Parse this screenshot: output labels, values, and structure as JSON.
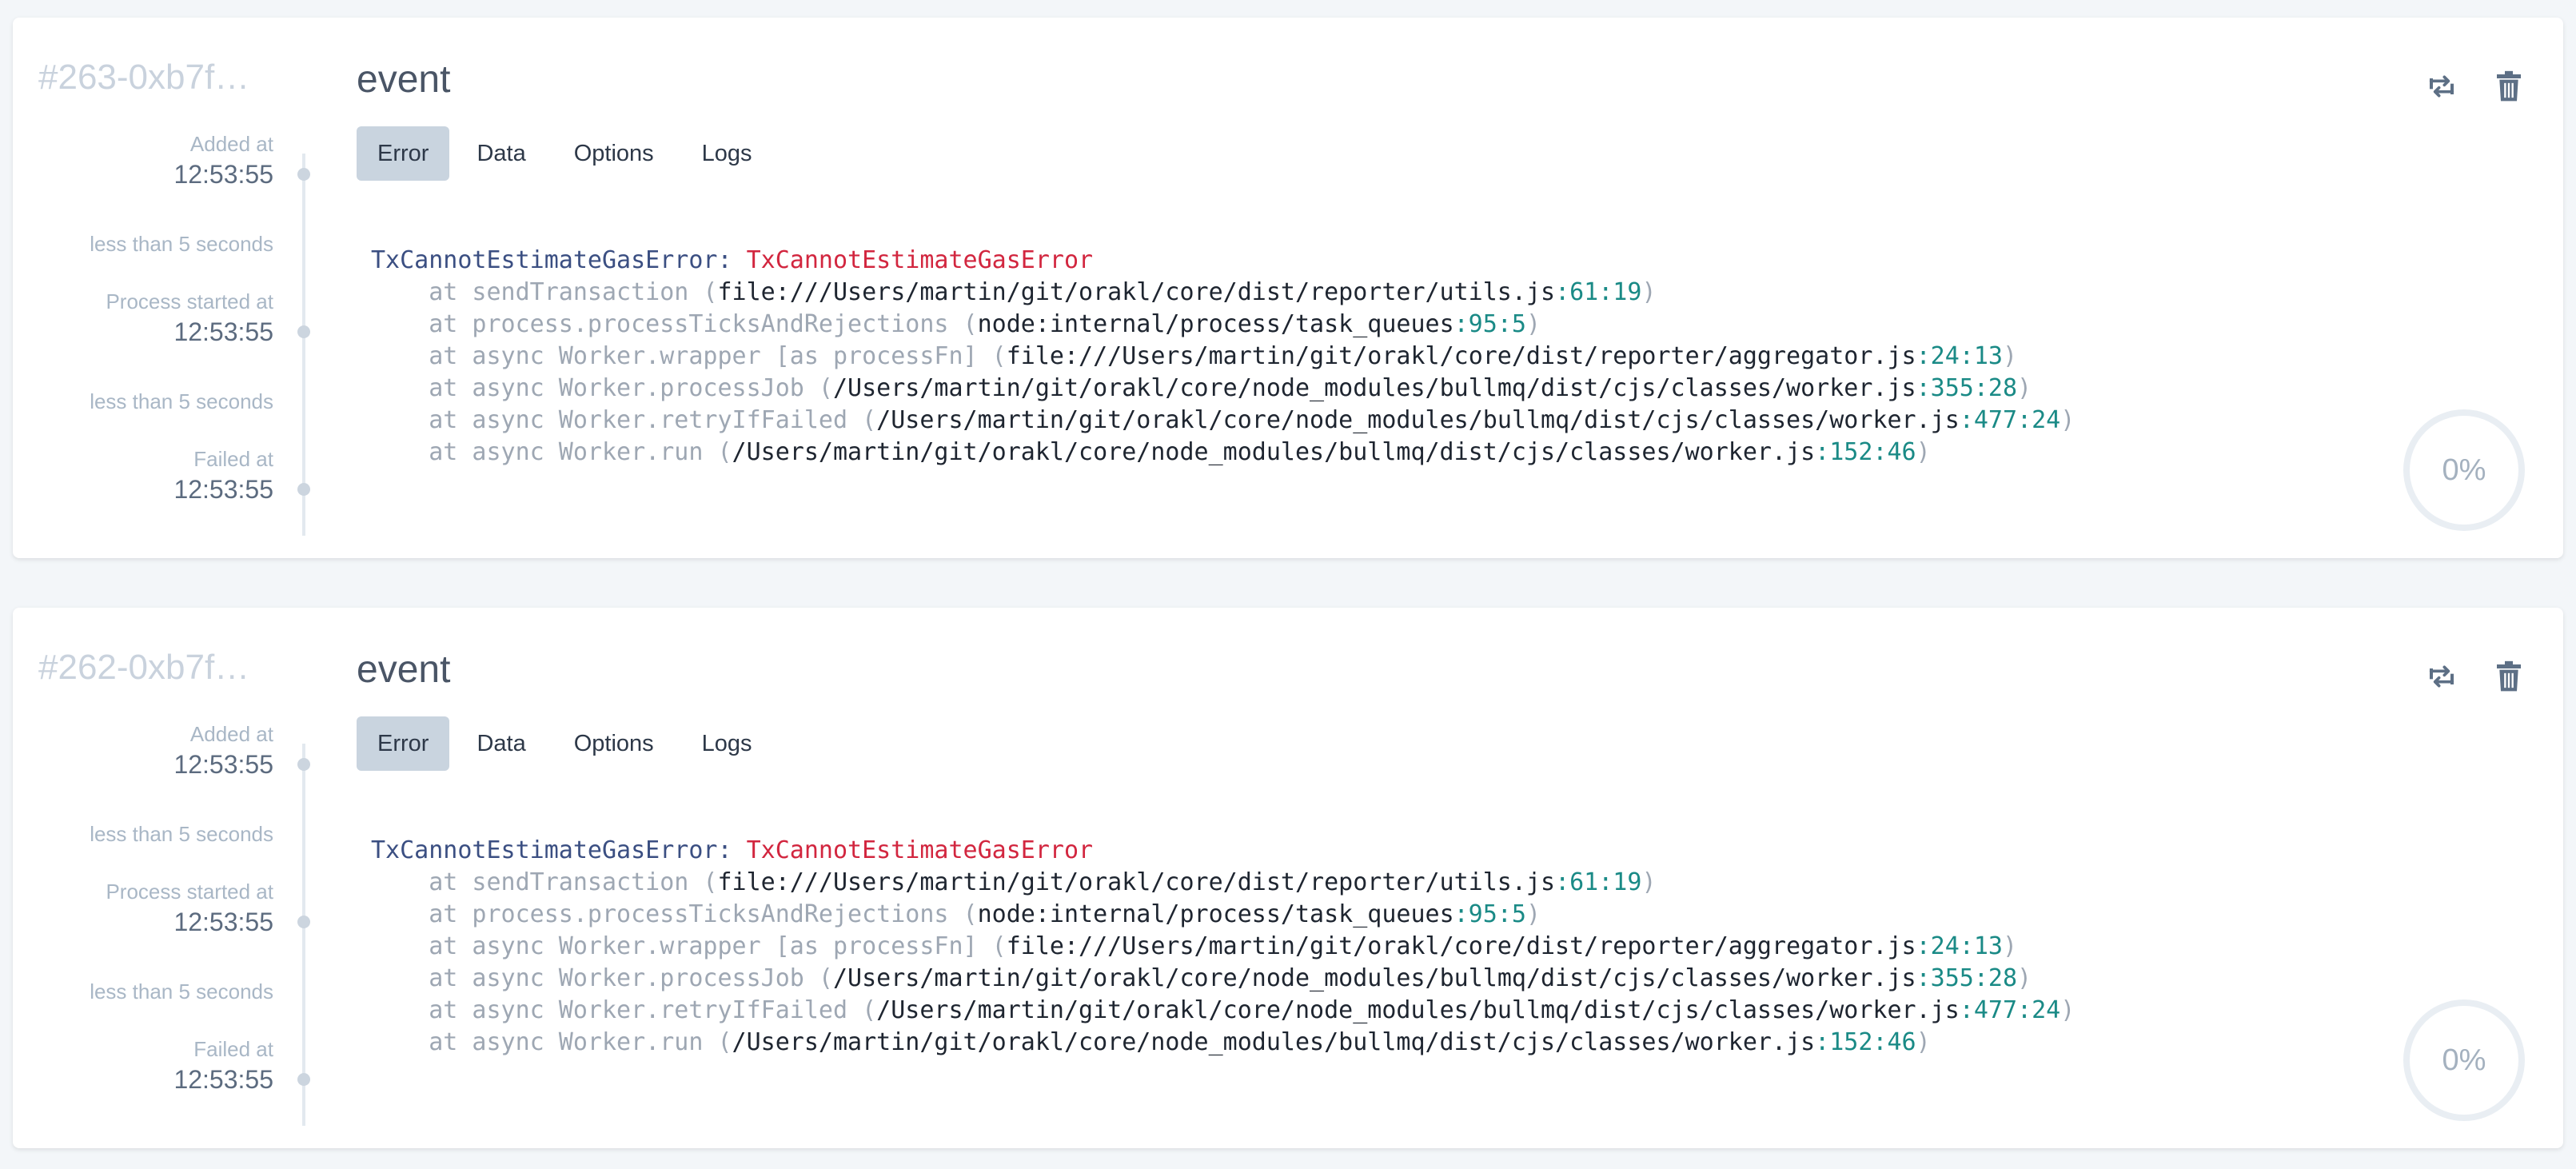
{
  "jobs": [
    {
      "id": "#263-0xb7f…",
      "name": "event",
      "tabs": [
        "Error",
        "Data",
        "Options",
        "Logs"
      ],
      "active_tab": "Error",
      "timeline": {
        "added_label": "Added at",
        "added_time": "12:53:55",
        "wait_duration": "less than 5 seconds",
        "started_label": "Process started at",
        "started_time": "12:53:55",
        "process_duration": "less than 5 seconds",
        "failed_label": "Failed at",
        "failed_time": "12:53:55"
      },
      "error": {
        "name": "TxCannotEstimateGasError:",
        "message": "TxCannotEstimateGasError",
        "frames": [
          {
            "fn": "at sendTransaction (",
            "path": "file:///Users/martin/git/orakl/core/dist/reporter/utils.js",
            "loc": ":61:19",
            "close": ")"
          },
          {
            "fn": "at process.processTicksAndRejections (",
            "path": "node:internal/process/task_queues",
            "loc": ":95:5",
            "close": ")"
          },
          {
            "fn": "at async Worker.wrapper [as processFn] (",
            "path": "file:///Users/martin/git/orakl/core/dist/reporter/aggregator.js",
            "loc": ":24:13",
            "close": ")"
          },
          {
            "fn": "at async Worker.processJob (",
            "path": "/Users/martin/git/orakl/core/node_modules/bullmq/dist/cjs/classes/worker.js",
            "loc": ":355:28",
            "close": ")"
          },
          {
            "fn": "at async Worker.retryIfFailed (",
            "path": "/Users/martin/git/orakl/core/node_modules/bullmq/dist/cjs/classes/worker.js",
            "loc": ":477:24",
            "close": ")"
          },
          {
            "fn": "at async Worker.run (",
            "path": "/Users/martin/git/orakl/core/node_modules/bullmq/dist/cjs/classes/worker.js",
            "loc": ":152:46",
            "close": ")"
          }
        ]
      },
      "progress": "0%"
    },
    {
      "id": "#262-0xb7f…",
      "name": "event",
      "tabs": [
        "Error",
        "Data",
        "Options",
        "Logs"
      ],
      "active_tab": "Error",
      "timeline": {
        "added_label": "Added at",
        "added_time": "12:53:55",
        "wait_duration": "less than 5 seconds",
        "started_label": "Process started at",
        "started_time": "12:53:55",
        "process_duration": "less than 5 seconds",
        "failed_label": "Failed at",
        "failed_time": "12:53:55"
      },
      "error": {
        "name": "TxCannotEstimateGasError:",
        "message": "TxCannotEstimateGasError",
        "frames": [
          {
            "fn": "at sendTransaction (",
            "path": "file:///Users/martin/git/orakl/core/dist/reporter/utils.js",
            "loc": ":61:19",
            "close": ")"
          },
          {
            "fn": "at process.processTicksAndRejections (",
            "path": "node:internal/process/task_queues",
            "loc": ":95:5",
            "close": ")"
          },
          {
            "fn": "at async Worker.wrapper [as processFn] (",
            "path": "file:///Users/martin/git/orakl/core/dist/reporter/aggregator.js",
            "loc": ":24:13",
            "close": ")"
          },
          {
            "fn": "at async Worker.processJob (",
            "path": "/Users/martin/git/orakl/core/node_modules/bullmq/dist/cjs/classes/worker.js",
            "loc": ":355:28",
            "close": ")"
          },
          {
            "fn": "at async Worker.retryIfFailed (",
            "path": "/Users/martin/git/orakl/core/node_modules/bullmq/dist/cjs/classes/worker.js",
            "loc": ":477:24",
            "close": ")"
          },
          {
            "fn": "at async Worker.run (",
            "path": "/Users/martin/git/orakl/core/node_modules/bullmq/dist/cjs/classes/worker.js",
            "loc": ":152:46",
            "close": ")"
          }
        ]
      },
      "progress": "0%"
    }
  ],
  "icons": {
    "retry": "retry-icon",
    "delete": "trash-icon"
  },
  "colors": {
    "error_message": "#d2263f",
    "location": "#1a8a86",
    "active_tab": "#c9d4df"
  }
}
